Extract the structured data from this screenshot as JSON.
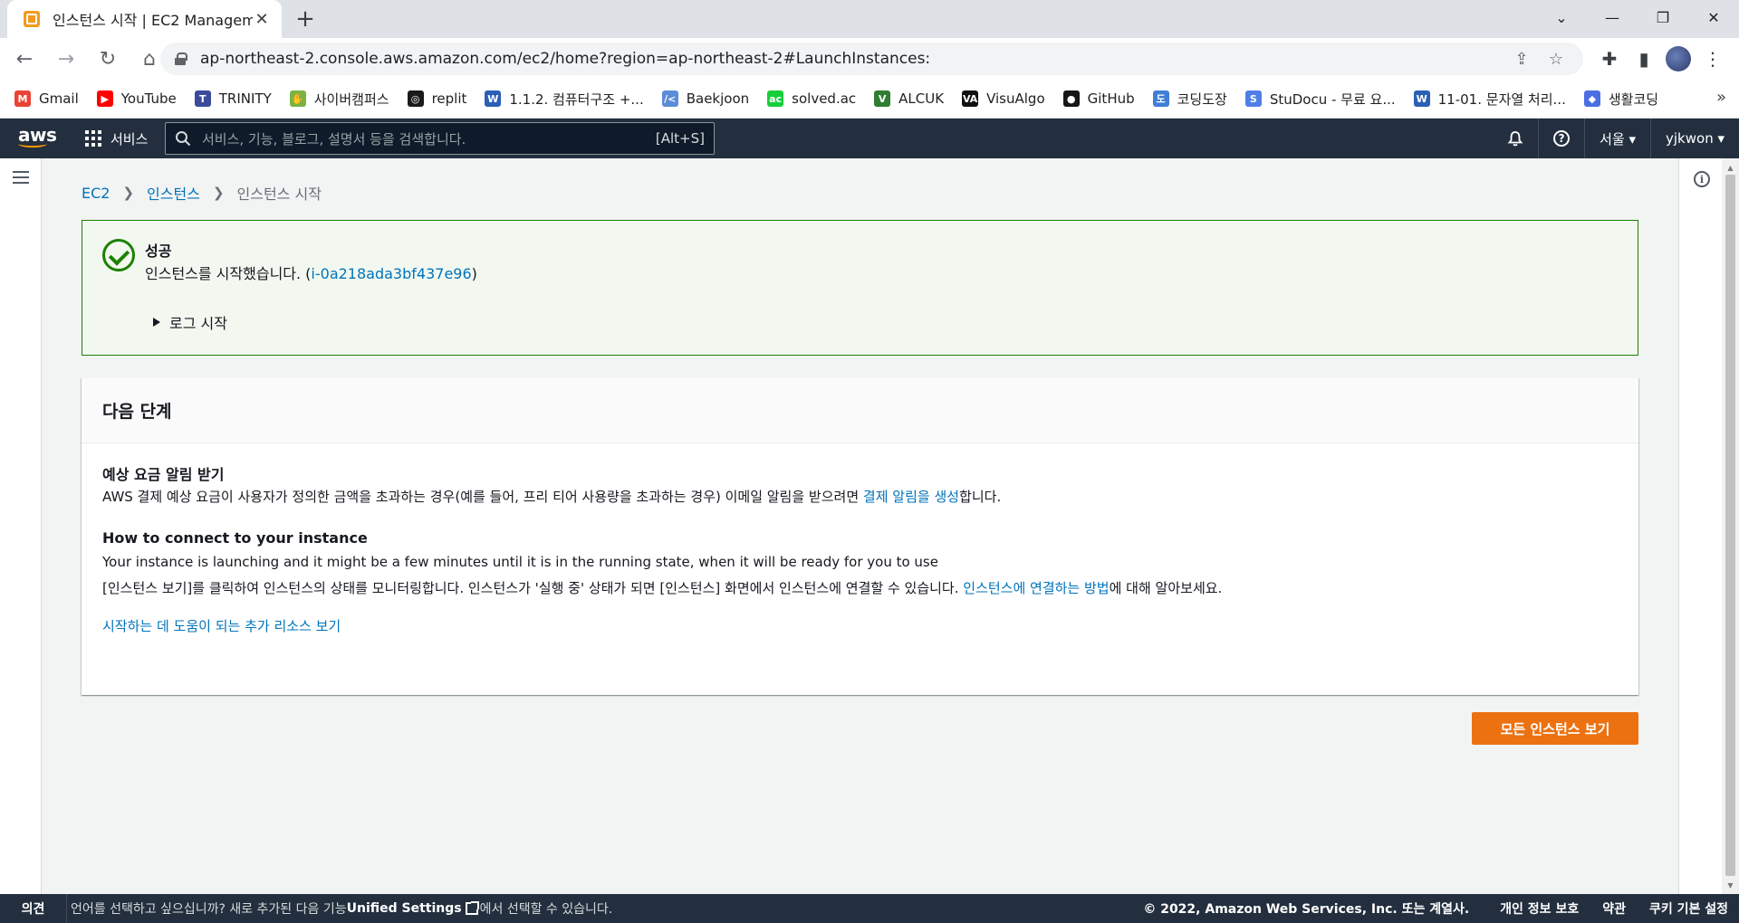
{
  "browser": {
    "tab_title": "인스턴스 시작 | EC2 Manageme",
    "url": "ap-northeast-2.console.aws.amazon.com/ec2/home?region=ap-northeast-2#LaunchInstances:",
    "bookmarks": [
      {
        "label": "Gmail",
        "icon_color": "#ea4335",
        "icon_text": "M"
      },
      {
        "label": "YouTube",
        "icon_color": "#ff0000",
        "icon_text": "▶"
      },
      {
        "label": "TRINITY",
        "icon_color": "#3b4a9b",
        "icon_text": "T"
      },
      {
        "label": "사이버캠퍼스",
        "icon_color": "#7cb342",
        "icon_text": "✋"
      },
      {
        "label": "replit",
        "icon_color": "#1a1a1a",
        "icon_text": "◎"
      },
      {
        "label": "1.1.2. 컴퓨터구조 +...",
        "icon_color": "#2b5fb4",
        "icon_text": "W"
      },
      {
        "label": "Baekjoon",
        "icon_color": "#5b8cd8",
        "icon_text": "/<"
      },
      {
        "label": "solved.ac",
        "icon_color": "#17ce3a",
        "icon_text": "ac"
      },
      {
        "label": "ALCUK",
        "icon_color": "#2e7d32",
        "icon_text": "V"
      },
      {
        "label": "VisuAlgo",
        "icon_color": "#111111",
        "icon_text": "VA"
      },
      {
        "label": "GitHub",
        "icon_color": "#181717",
        "icon_text": "●"
      },
      {
        "label": "코딩도장",
        "icon_color": "#3f7fd6",
        "icon_text": "도"
      },
      {
        "label": "StuDocu - 무료 요...",
        "icon_color": "#4f7fe6",
        "icon_text": "S"
      },
      {
        "label": "11-01. 문자열 처리...",
        "icon_color": "#2b5fb4",
        "icon_text": "W"
      },
      {
        "label": "생활코딩",
        "icon_color": "#4a6fe3",
        "icon_text": "◆"
      }
    ],
    "bookmarks_more": "»"
  },
  "aws": {
    "logo": "aws",
    "services_label": "서비스",
    "search_placeholder": "서비스, 기능, 블로그, 설명서 등을 검색합니다.",
    "search_shortcut": "[Alt+S]",
    "region": "서울 ▾",
    "user": "yjkwon ▾"
  },
  "breadcrumb": {
    "items": [
      "EC2",
      "인스턴스"
    ],
    "current": "인스턴스 시작"
  },
  "flash": {
    "title": "성공",
    "message_prefix": "인스턴스를 시작했습니다. (",
    "instance_id": "i-0a218ada3bf437e96",
    "message_suffix": ")",
    "log_toggle": "로그 시작"
  },
  "next_steps": {
    "title": "다음 단계",
    "billing": {
      "title": "예상 요금 알림 받기",
      "text_prefix": "AWS 결제 예상 요금이 사용자가 정의한 금액을 초과하는 경우(예를 들어, 프리 티어 사용량을 초과하는 경우) 이메일 알림을 받으려면 ",
      "link": "결제 알림을 생성",
      "text_suffix": "합니다."
    },
    "connect": {
      "title": "How to connect to your instance",
      "line1": "Your instance is launching and it might be a few minutes until it is in the running state, when it will be ready for you to use",
      "line2_prefix": "[인스턴스 보기]를 클릭하여 인스턴스의 상태를 모니터링합니다. 인스턴스가 '실행 중' 상태가 되면 [인스턴스] 화면에서 인스턴스에 연결할 수 있습니다. ",
      "line2_link": "인스턴스에 연결하는 방법",
      "line2_suffix": "에 대해 알아보세요."
    },
    "resources_link": "시작하는 데 도움이 되는 추가 리소스 보기"
  },
  "primary_button": "모든 인스턴스 보기",
  "footer": {
    "feedback": "의견",
    "message_prefix": "언어를 선택하고 싶으십니까? 새로 추가된 다음 기능",
    "unified_settings": "Unified Settings",
    "message_suffix": "에서 선택할 수 있습니다.",
    "copyright": "© 2022, Amazon Web Services, Inc. 또는 계열사.",
    "privacy": "개인 정보 보호",
    "terms": "약관",
    "cookies": "쿠키 기본 설정"
  }
}
